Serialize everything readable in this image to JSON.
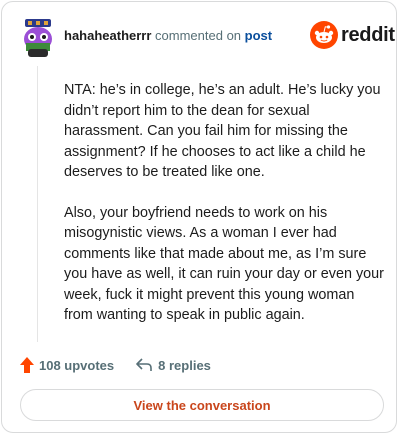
{
  "header": {
    "username": "hahaheatherrr",
    "action_text": "commented on",
    "post_link": "post",
    "brand": "reddit"
  },
  "comment": {
    "paragraphs": [
      "NTA: he’s in college, he’s an adult. He’s lucky you didn’t report him to the dean for sexual harassment. Can you fail him for missing the assignment? If he chooses to act like a child he deserves to be treated like one.",
      "Also, your boyfriend needs to work on his misogynistic views. As a woman I ever had comments like that made about me, as I’m sure you have as well, it can ruin your day or even your week, fuck it might prevent this young woman from wanting to speak in public again."
    ]
  },
  "footer": {
    "upvotes": "108 upvotes",
    "replies": "8 replies",
    "view_button": "View the conversation"
  },
  "colors": {
    "accent": "#c9461c",
    "upvote": "#ff4500",
    "link": "#0a4e9c"
  },
  "icons": {
    "avatar": "snoo-avatar-icon",
    "logo": "reddit-logo-icon",
    "upvote": "upvote-arrow-icon",
    "reply": "reply-arrow-icon"
  }
}
